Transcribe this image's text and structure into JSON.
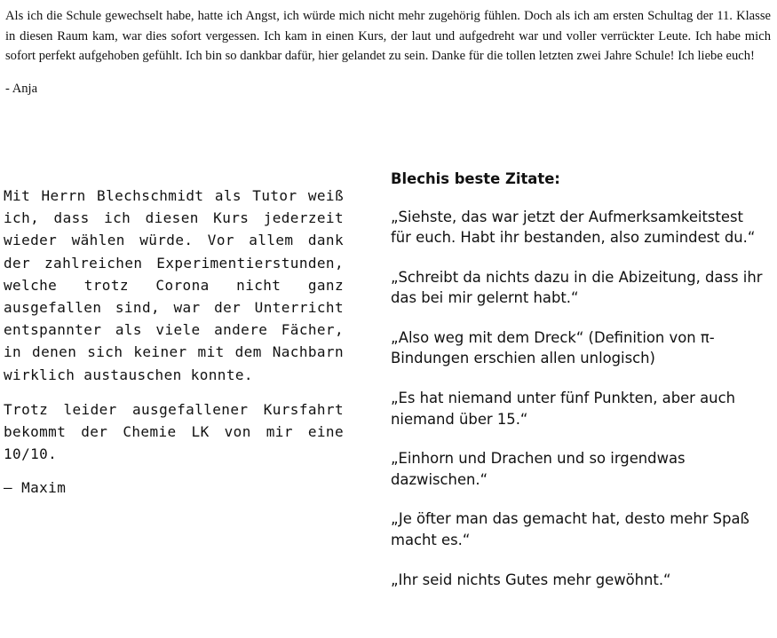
{
  "top": {
    "paragraph": "Als ich die Schule gewechselt habe, hatte ich Angst, ich würde mich nicht mehr zugehörig fühlen. Doch als ich am ersten Schultag der 11. Klasse in diesen Raum kam, war dies sofort vergessen. Ich kam in einen Kurs, der laut und aufgedreht war und voller verrückter Leute. Ich habe mich sofort perfekt aufgehoben gefühlt. Ich bin so dankbar dafür, hier gelandet zu sein. Danke für die tollen letzten zwei Jahre Schule! Ich liebe euch!",
    "signature": "- Anja"
  },
  "left": {
    "paragraph_1": "Mit Herrn Blechschmidt als Tutor weiß ich, dass ich diesen Kurs jederzeit wieder wählen würde. Vor allem dank der zahlreichen Experimentierstunden, welche trotz Corona nicht ganz ausgefallen sind, war der Unterricht entspannter als viele andere Fächer, in denen sich keiner mit dem Nachbarn wirklich austauschen konnte.",
    "paragraph_2": "Trotz leider ausgefallener Kursfahrt bekommt der Chemie LK von mir eine 10/10.",
    "signature": "– Maxim"
  },
  "right": {
    "heading": "Blechis beste Zitate:",
    "quotes": [
      "„Siehste, das war jetzt der Aufmerksamkeitstest für euch. Habt ihr bestanden, also zumindest du.“",
      "„Schreibt da nichts dazu in die Abizeitung, dass ihr das bei mir gelernt habt.“",
      "„Also weg mit dem Dreck“ (Definition von π-Bindungen erschien allen unlogisch)",
      "„Es hat niemand unter fünf Punkten, aber auch niemand über 15.“",
      "„Einhorn und Drachen und so irgendwas dazwischen.“",
      "„Je öfter man das gemacht hat, desto mehr Spaß macht es.“",
      "„Ihr seid nichts Gutes mehr gewöhnt.“"
    ]
  }
}
